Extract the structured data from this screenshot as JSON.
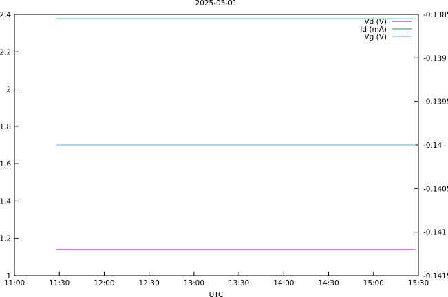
{
  "chart_data": {
    "type": "line",
    "title": "2025-05-01",
    "xlabel": "UTC",
    "x_ticks": [
      "11:00",
      "11:30",
      "12:00",
      "12:30",
      "13:00",
      "13:30",
      "14:00",
      "14:30",
      "15:00",
      "15:30"
    ],
    "xlim": [
      "11:00",
      "15:30"
    ],
    "y_left": {
      "ylim": [
        1,
        2.4
      ],
      "ticks": [
        "1",
        "1.2",
        "1.4",
        "1.6",
        "1.8",
        "2",
        "2.2",
        "2.4"
      ]
    },
    "y_right": {
      "ylim": [
        -0.1415,
        -0.1385
      ],
      "ticks": [
        "-0.1415",
        "-0.141",
        "-0.1405",
        "-0.14",
        "-0.1395",
        "-0.139",
        "-0.1385"
      ]
    },
    "legend_position": "top-right",
    "grid": false,
    "series": [
      {
        "name": "Vd (V)",
        "axis": "left",
        "color": "#9400d3",
        "x": [
          "11:28",
          "15:28"
        ],
        "y": [
          1.14,
          1.14
        ]
      },
      {
        "name": "Id (mA)",
        "axis": "right",
        "color": "#009e73",
        "x": [
          "11:28",
          "15:28"
        ],
        "y": [
          -0.13855,
          -0.13855
        ]
      },
      {
        "name": "Vg (V)",
        "axis": "left",
        "color": "#56b4e9",
        "x": [
          "11:28",
          "15:28"
        ],
        "y": [
          1.7,
          1.7
        ]
      }
    ]
  }
}
